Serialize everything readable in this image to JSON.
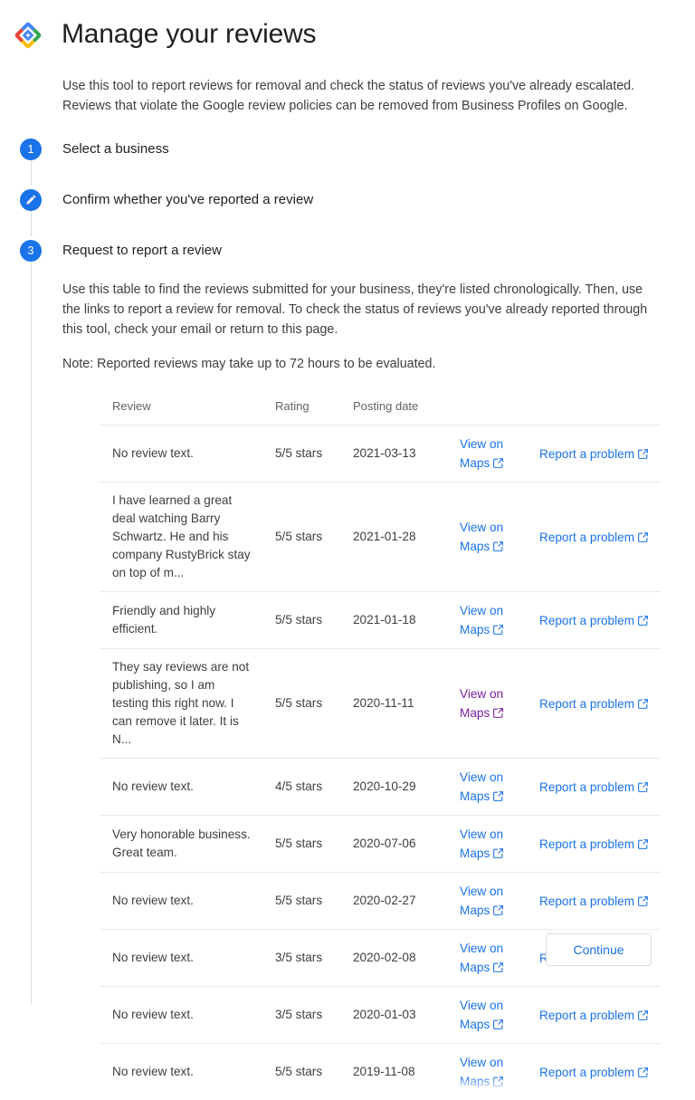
{
  "header": {
    "logo_icon": "google-diamond-logo-icon",
    "title": "Manage your reviews"
  },
  "intro": {
    "line1": "Use this tool to report reviews for removal and check the status of reviews you've already escalated.",
    "line2": "Reviews that violate the Google review policies can be removed from Business Profiles on Google."
  },
  "steps": [
    {
      "marker": "1",
      "marker_type": "number",
      "title": "Select a business"
    },
    {
      "marker": "",
      "marker_type": "pencil-icon",
      "title": "Confirm whether you've reported a review"
    },
    {
      "marker": "3",
      "marker_type": "number",
      "title": "Request to report a review"
    }
  ],
  "step3_body": {
    "paragraph1": "Use this table to find the reviews submitted for your business, they're listed chronologically. Then, use the links to report a review for removal. To check the status of reviews you've already reported through this tool, check your email or return to this page.",
    "note": "Note: Reported reviews may take up to 72 hours to be evaluated."
  },
  "table": {
    "columns": [
      "Review",
      "Rating",
      "Posting date",
      "",
      ""
    ],
    "maps_link_label": "View on Maps",
    "report_link_label": "Report a problem",
    "external_link_icon": "external-link-icon",
    "rows": [
      {
        "review": "No review text.",
        "rating": "5/5 stars",
        "date": "2021-03-13",
        "maps_label": "View on Maps",
        "report_label": "Report a problem",
        "maps_visited": false
      },
      {
        "review": "I have learned a great deal watching Barry Schwartz. He and his company RustyBrick stay on top of m...",
        "rating": "5/5 stars",
        "date": "2021-01-28",
        "maps_label": "View on Maps",
        "report_label": "Report a problem",
        "maps_visited": false
      },
      {
        "review": "Friendly and highly efficient.",
        "rating": "5/5 stars",
        "date": "2021-01-18",
        "maps_label": "View on Maps",
        "report_label": "Report a problem",
        "maps_visited": false
      },
      {
        "review": "They say reviews are not publishing, so I am testing this right now. I can remove it later. It is N...",
        "rating": "5/5 stars",
        "date": "2020-11-11",
        "maps_label": "View on Maps",
        "report_label": "Report a problem",
        "maps_visited": true
      },
      {
        "review": "No review text.",
        "rating": "4/5 stars",
        "date": "2020-10-29",
        "maps_label": "View on Maps",
        "report_label": "Report a problem",
        "maps_visited": false
      },
      {
        "review": "Very honorable business. Great team.",
        "rating": "5/5 stars",
        "date": "2020-07-06",
        "maps_label": "View on Maps",
        "report_label": "Report a problem",
        "maps_visited": false
      },
      {
        "review": "No review text.",
        "rating": "5/5 stars",
        "date": "2020-02-27",
        "maps_label": "View on Maps",
        "report_label": "Report a problem",
        "maps_visited": false
      },
      {
        "review": "No review text.",
        "rating": "3/5 stars",
        "date": "2020-02-08",
        "maps_label": "View on Maps",
        "report_label": "Report a problem",
        "maps_visited": false
      },
      {
        "review": "No review text.",
        "rating": "3/5 stars",
        "date": "2020-01-03",
        "maps_label": "View on Maps",
        "report_label": "Report a problem",
        "maps_visited": false
      },
      {
        "review": "No review text.",
        "rating": "5/5 stars",
        "date": "2019-11-08",
        "maps_label": "View on Maps",
        "report_label": "Report a problem",
        "maps_visited": false,
        "clipped": true
      }
    ]
  },
  "footer": {
    "continue_label": "Continue"
  },
  "colors": {
    "accent_blue": "#1a73e8",
    "visited_purple": "#7b1fa2",
    "text_primary": "#202124",
    "text_secondary": "#3c4043",
    "text_muted": "#5f6368",
    "divider": "#e8eaed",
    "border": "#dadce0",
    "logo_blue": "#4285f4",
    "logo_red": "#ea4335",
    "logo_yellow": "#fbbc04",
    "logo_green": "#34a853"
  }
}
